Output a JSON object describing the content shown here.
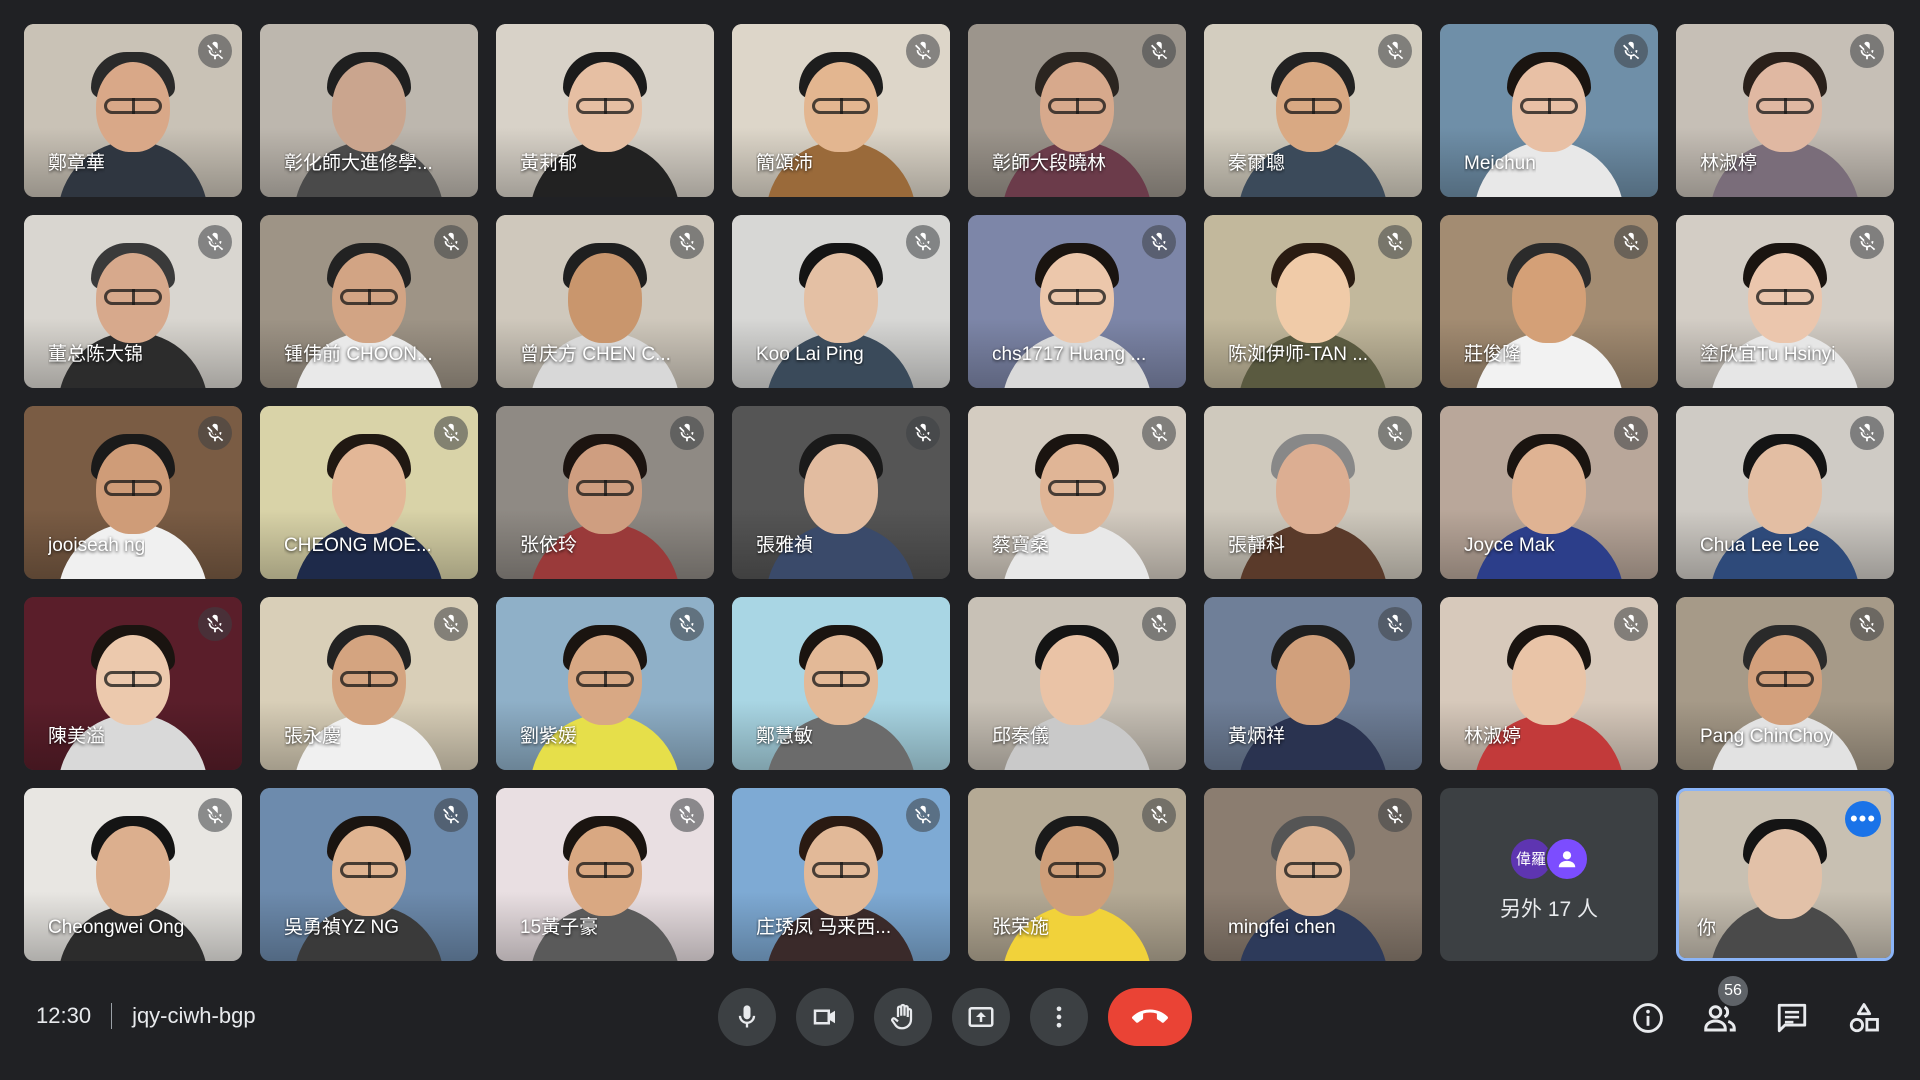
{
  "participants": [
    {
      "name": "鄭章華",
      "bg": "#c9c2b6",
      "skin": "#d9a888",
      "hair": "#2a2a2a",
      "shirt": "#2f3640",
      "glasses": true,
      "muted": true
    },
    {
      "name": "彰化師大進修學...",
      "bg": "#bdb7ae",
      "skin": "#caa58e",
      "hair": "#1f1f1f",
      "shirt": "#4a4a4a",
      "glasses": false,
      "muted": false
    },
    {
      "name": "黃莉郁",
      "bg": "#d8d2c8",
      "skin": "#e6bfa3",
      "hair": "#1b1b1b",
      "shirt": "#222222",
      "glasses": true,
      "muted": false
    },
    {
      "name": "簡頌沛",
      "bg": "#ddd6c9",
      "skin": "#e3b690",
      "hair": "#1d1d1d",
      "shirt": "#9a6a3a",
      "glasses": true,
      "muted": true
    },
    {
      "name": "彰師大段曉林",
      "bg": "#9c958c",
      "skin": "#d7a98c",
      "hair": "#2b2520",
      "shirt": "#6b3b4a",
      "glasses": true,
      "muted": true
    },
    {
      "name": "秦爾聰",
      "bg": "#d3cdbf",
      "skin": "#d9a983",
      "hair": "#222",
      "shirt": "#3b4a5a",
      "glasses": true,
      "muted": true
    },
    {
      "name": "Meichun",
      "bg": "#6f8fa8",
      "skin": "#e8c0a5",
      "hair": "#1a1410",
      "shirt": "#e8e8e8",
      "glasses": true,
      "muted": true
    },
    {
      "name": "林淑楟",
      "bg": "#c6bfb6",
      "skin": "#e0b8a2",
      "hair": "#2a201a",
      "shirt": "#7a6d7a",
      "glasses": true,
      "muted": true
    },
    {
      "name": "董总陈大锦",
      "bg": "#d9d6d0",
      "skin": "#d7a98c",
      "hair": "#3a3a3a",
      "shirt": "#2c2c2c",
      "glasses": true,
      "muted": true
    },
    {
      "name": "锺伟前 CHOON...",
      "bg": "#9e9486",
      "skin": "#d2a484",
      "hair": "#222",
      "shirt": "#e9e9e9",
      "glasses": true,
      "muted": true
    },
    {
      "name": "曾庆方 CHEN C...",
      "bg": "#cfc8bc",
      "skin": "#c9966d",
      "hair": "#1f1f1f",
      "shirt": "#d8d8d8",
      "glasses": false,
      "muted": true
    },
    {
      "name": "Koo Lai Ping",
      "bg": "#d7d7d5",
      "skin": "#e4c0a4",
      "hair": "#141414",
      "shirt": "#3a4a5a",
      "glasses": false,
      "muted": true
    },
    {
      "name": "chs1717 Huang ...",
      "bg": "#7d86a8",
      "skin": "#ecc7ab",
      "hair": "#1a1410",
      "shirt": "#d9d9d9",
      "glasses": true,
      "muted": true
    },
    {
      "name": "陈洳伊师-TAN ...",
      "bg": "#c2b89c",
      "skin": "#f0cba8",
      "hair": "#2a1c12",
      "shirt": "#5a5a40",
      "glasses": false,
      "muted": true
    },
    {
      "name": "莊俊隆",
      "bg": "#a38c72",
      "skin": "#d4a077",
      "hair": "#2b2b2b",
      "shirt": "#f2f2f2",
      "glasses": false,
      "muted": true
    },
    {
      "name": "塗欣宜Tu Hsinyi",
      "bg": "#d3cdc5",
      "skin": "#ebc6ad",
      "hair": "#1a1410",
      "shirt": "#e6e6e6",
      "glasses": true,
      "muted": true
    },
    {
      "name": "jooiseah ng",
      "bg": "#7a5c44",
      "skin": "#cf9c78",
      "hair": "#1a1a1a",
      "shirt": "#f0f0f0",
      "glasses": true,
      "muted": true
    },
    {
      "name": "CHEONG MOE...",
      "bg": "#d9d3a8",
      "skin": "#e3b797",
      "hair": "#201812",
      "shirt": "#1e2a4a",
      "glasses": false,
      "muted": true
    },
    {
      "name": "张依玲",
      "bg": "#8f8a84",
      "skin": "#cf9e80",
      "hair": "#1c1410",
      "shirt": "#9a3a3a",
      "glasses": true,
      "muted": true
    },
    {
      "name": "張雅禎",
      "bg": "#555",
      "skin": "#e2bca0",
      "hair": "#1a1a1a",
      "shirt": "#3a4a6a",
      "glasses": false,
      "muted": true
    },
    {
      "name": "蔡寶桑",
      "bg": "#d4ccc1",
      "skin": "#e0b596",
      "hair": "#1a1410",
      "shirt": "#e8e8e8",
      "glasses": true,
      "muted": true
    },
    {
      "name": "張靜科",
      "bg": "#cfc9bd",
      "skin": "#dcae92",
      "hair": "#888888",
      "shirt": "#5a3a2a",
      "glasses": false,
      "muted": true
    },
    {
      "name": "Joyce Mak",
      "bg": "#b9a79a",
      "skin": "#dfb393",
      "hair": "#1a1410",
      "shirt": "#2c3e8a",
      "glasses": false,
      "muted": true
    },
    {
      "name": "Chua Lee Lee",
      "bg": "#cfcbc5",
      "skin": "#e3bea3",
      "hair": "#141414",
      "shirt": "#2e4a7a",
      "glasses": false,
      "muted": true
    },
    {
      "name": "陳美溢",
      "bg": "#5a1e2a",
      "skin": "#ecc9ad",
      "hair": "#1a1410",
      "shirt": "#d9d9d9",
      "glasses": true,
      "muted": true
    },
    {
      "name": "張永慶",
      "bg": "#d9cfb8",
      "skin": "#d4a480",
      "hair": "#222",
      "shirt": "#f0f0f0",
      "glasses": true,
      "muted": true
    },
    {
      "name": "劉紫媛",
      "bg": "#8fb0c8",
      "skin": "#d8a884",
      "hair": "#1a1410",
      "shirt": "#e6df4a",
      "glasses": true,
      "muted": true
    },
    {
      "name": "鄭慧敏",
      "bg": "#a9d6e4",
      "skin": "#e3b997",
      "hair": "#1a1410",
      "shirt": "#6b6b6b",
      "glasses": true,
      "muted": false
    },
    {
      "name": "邱秦儀",
      "bg": "#c8c1b6",
      "skin": "#eac3a6",
      "hair": "#141414",
      "shirt": "#c9c9c9",
      "glasses": false,
      "muted": true
    },
    {
      "name": "黃炳祥",
      "bg": "#6f7f98",
      "skin": "#d1a07c",
      "hair": "#1f1f1f",
      "shirt": "#2a3350",
      "glasses": false,
      "muted": true
    },
    {
      "name": "林淑婷",
      "bg": "#d7c9bb",
      "skin": "#e9c4a7",
      "hair": "#1a1410",
      "shirt": "#c23a3a",
      "glasses": false,
      "muted": true
    },
    {
      "name": "Pang ChinChoy",
      "bg": "#a69a88",
      "skin": "#d3a07c",
      "hair": "#2a2a2a",
      "shirt": "#e2e2e2",
      "glasses": true,
      "muted": true
    },
    {
      "name": "Cheongwei Ong",
      "bg": "#e8e6e2",
      "skin": "#dcaf8e",
      "hair": "#141414",
      "shirt": "#2c2c2c",
      "glasses": false,
      "muted": true
    },
    {
      "name": "吳勇禎YZ NG",
      "bg": "#6d8bad",
      "skin": "#e0b491",
      "hair": "#1a1410",
      "shirt": "#3a3a3a",
      "glasses": true,
      "muted": true
    },
    {
      "name": "15黃子豪",
      "bg": "#e9dfe2",
      "skin": "#d9a882",
      "hair": "#1a1410",
      "shirt": "#5a5a5a",
      "glasses": true,
      "muted": true
    },
    {
      "name": "庄琇凤 马来西...",
      "bg": "#7eaad4",
      "skin": "#e2b998",
      "hair": "#2a1a12",
      "shirt": "#3a2a2a",
      "glasses": true,
      "muted": true
    },
    {
      "name": "张荣施",
      "bg": "#b5aa95",
      "skin": "#cf9f7a",
      "hair": "#1a1a1a",
      "shirt": "#f1d23a",
      "glasses": true,
      "muted": true
    },
    {
      "name": "mingfei chen",
      "bg": "#8b7d70",
      "skin": "#dcb393",
      "hair": "#555",
      "shirt": "#2d3a5a",
      "glasses": true,
      "muted": true
    }
  ],
  "others": {
    "avatar1": "偉羅",
    "label": "另外 17 人"
  },
  "self": {
    "name": "你",
    "bg": "#c8c0b2",
    "skin": "#e2c1a8",
    "hair": "#141414",
    "shirt": "#4a4a4a"
  },
  "meeting": {
    "time": "12:30",
    "code": "jqy-ciwh-bgp"
  },
  "people_count": "56",
  "colors": {
    "end_call": "#ea4335",
    "accent": "#8ab4f8",
    "bar_bg": "#202124"
  }
}
